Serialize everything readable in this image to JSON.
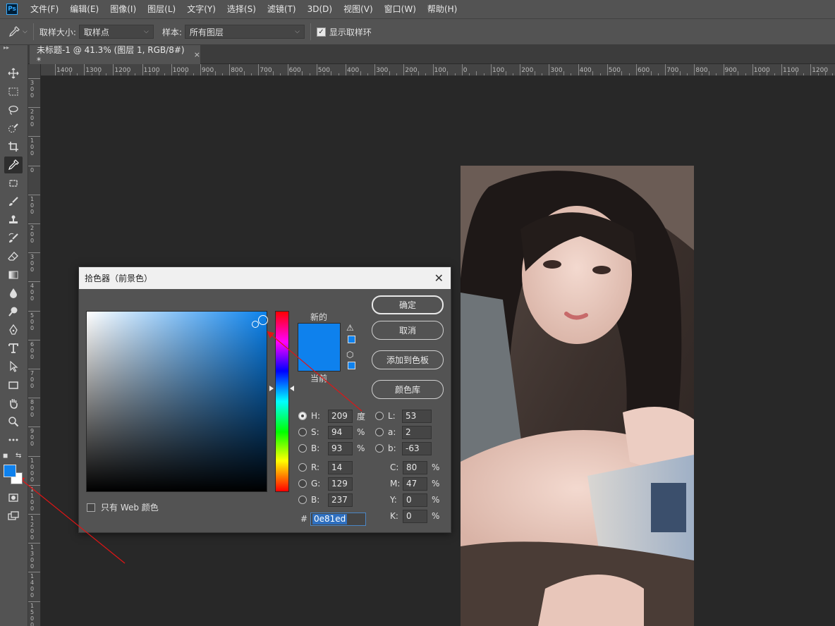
{
  "menu": [
    "文件(F)",
    "编辑(E)",
    "图像(I)",
    "图层(L)",
    "文字(Y)",
    "选择(S)",
    "滤镜(T)",
    "3D(D)",
    "视图(V)",
    "窗口(W)",
    "帮助(H)"
  ],
  "app_logo": "Ps",
  "options": {
    "sample_size_label": "取样大小:",
    "sample_size_value": "取样点",
    "sample_label": "样本:",
    "sample_value": "所有图层",
    "show_ring_label": "显示取样环",
    "show_ring_checked": true
  },
  "document_tab": {
    "title": "未标题-1 @ 41.3% (图层 1, RGB/8#) *",
    "close": "×"
  },
  "ruler_h": [
    "1400",
    "1300",
    "1200",
    "1100",
    "1000",
    "900",
    "800",
    "700",
    "600",
    "500",
    "400",
    "300",
    "200",
    "100",
    "0",
    "100",
    "200",
    "300",
    "400",
    "500",
    "600",
    "700",
    "800",
    "900",
    "1000",
    "1100",
    "1200"
  ],
  "ruler_v": [
    "300",
    "200",
    "100",
    "0",
    "100",
    "200",
    "300",
    "400",
    "500",
    "600",
    "700",
    "800",
    "900",
    "1000",
    "1100",
    "1200",
    "1300",
    "1400",
    "1500"
  ],
  "tools": [
    "move-icon",
    "marquee-icon",
    "lasso-icon",
    "quick-select-icon",
    "crop-icon",
    "eyedropper-icon",
    "patch-icon",
    "brush-icon",
    "stamp-icon",
    "history-brush-icon",
    "eraser-icon",
    "gradient-icon",
    "blur-icon",
    "dodge-icon",
    "pen-icon",
    "type-icon",
    "path-select-icon",
    "rectangle-icon",
    "hand-icon",
    "zoom-icon",
    "more-icon"
  ],
  "foreground_color": "#0e81ed",
  "background_color": "#ffffff",
  "dialog": {
    "title": "拾色器（前景色）",
    "close": "✕",
    "new_label": "新的",
    "current_label": "当前",
    "buttons": {
      "ok": "确定",
      "cancel": "取消",
      "add_swatch": "添加到色板",
      "color_libraries": "颜色库"
    },
    "hsb": {
      "h_label": "H:",
      "h_value": "209",
      "h_unit": "度",
      "s_label": "S:",
      "s_value": "94",
      "s_unit": "%",
      "b_label": "B:",
      "b_value": "93",
      "b_unit": "%"
    },
    "lab": {
      "l_label": "L:",
      "l_value": "53",
      "a_label": "a:",
      "a_value": "2",
      "b_label": "b:",
      "b_value": "-63"
    },
    "rgb": {
      "r_label": "R:",
      "r_value": "14",
      "g_label": "G:",
      "g_value": "129",
      "b_label": "B:",
      "b_value": "237"
    },
    "cmyk": {
      "c_label": "C:",
      "c_value": "80",
      "m_label": "M:",
      "m_value": "47",
      "y_label": "Y:",
      "y_value": "0",
      "k_label": "K:",
      "k_value": "0",
      "unit": "%"
    },
    "hex_label": "#",
    "hex_value": "0e81ed",
    "web_only_label": "只有 Web 颜色",
    "web_only_checked": false,
    "selected_color": "#0e81ed"
  }
}
